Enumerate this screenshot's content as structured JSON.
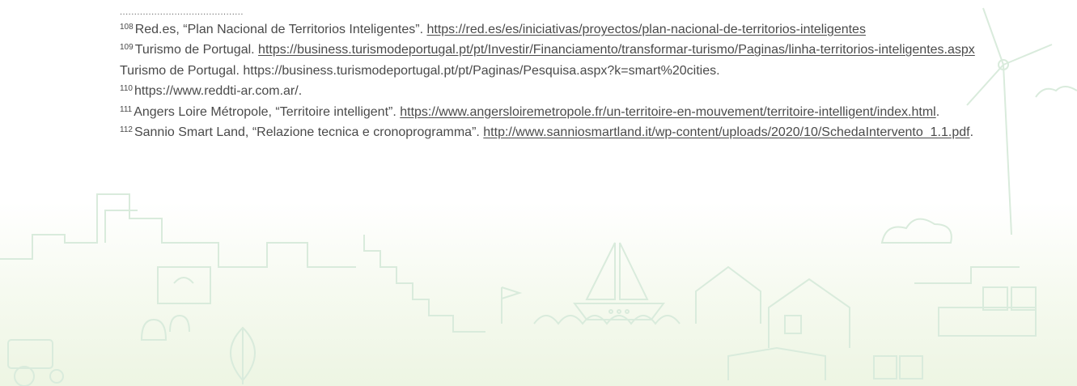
{
  "separator": "...........................................",
  "footnotes": {
    "fn108": {
      "number": "108",
      "text": "Red.es, “Plan Nacional de Territorios Inteligentes”. ",
      "link": "https://red.es/es/iniciativas/proyectos/plan-nacional-de-territorios-inteligentes"
    },
    "fn109": {
      "number": "109",
      "text": "Turismo de Portugal. ",
      "link": "https://business.turismodeportugal.pt/pt/Investir/Financiamento/transformar-turismo/Paginas/linha-territorios-inteligentes.aspx",
      "tail": "  Turismo de Portugal. https://business.turismodeportugal.pt/pt/Paginas/Pesquisa.aspx?k=smart%20cities."
    },
    "fn110": {
      "number": "110",
      "text": "https://www.reddti-ar.com.ar/."
    },
    "fn111": {
      "number": "111",
      "text": "Angers Loire Métropole, “Territoire intelligent”. ",
      "link": "https://www.angersloiremetropole.fr/un-territoire-en-mouvement/territoire-intelligent/index.html",
      "tail": "."
    },
    "fn112": {
      "number": "112",
      "text": "Sannio Smart Land, “Relazione tecnica e cronoprogramma”. ",
      "link": "http://www.sanniosmartland.it/wp-content/uploads/2020/10/SchedaIntervento_1.1.pdf",
      "tail": "."
    }
  },
  "colors": {
    "text": "#4a4a4a",
    "illustration_line": "#d9ebdc",
    "background_bottom": "#edf5e3"
  }
}
